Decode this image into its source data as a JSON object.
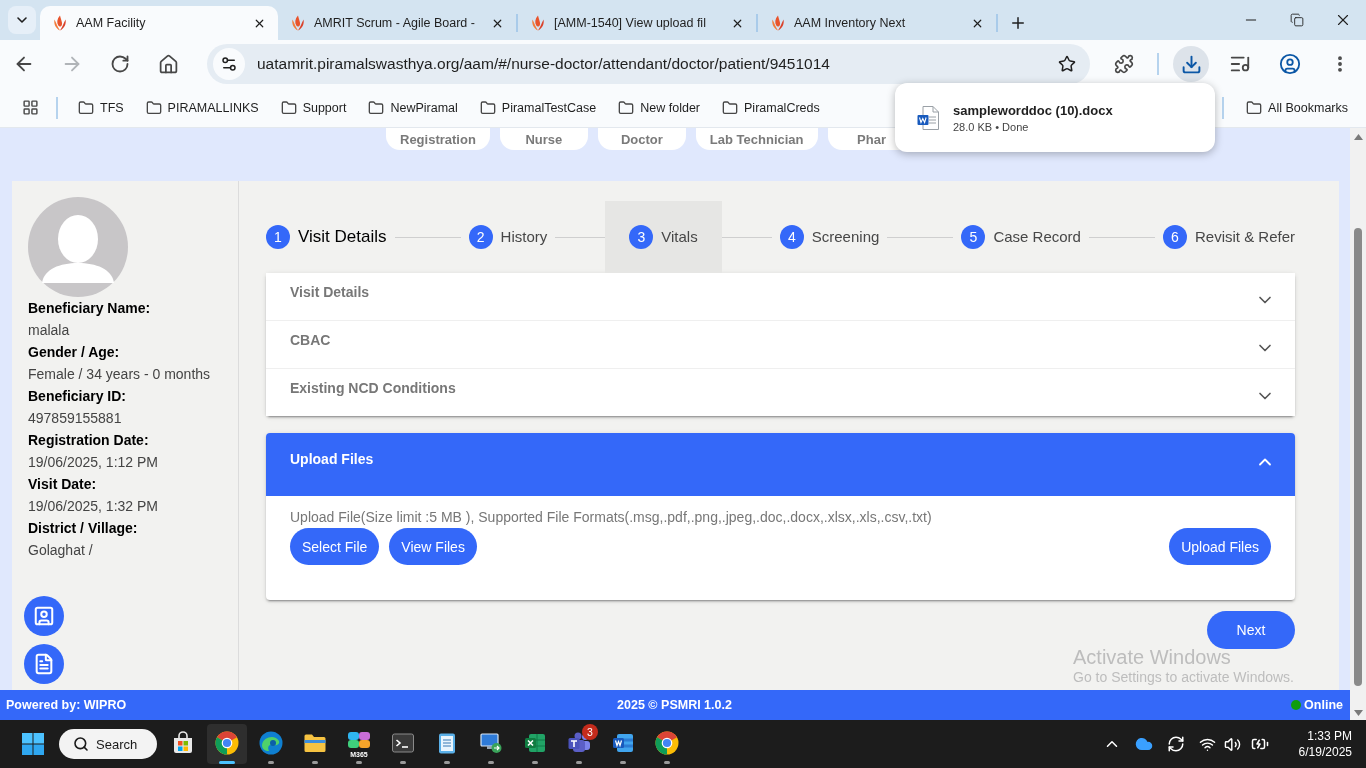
{
  "browser": {
    "tabs": [
      {
        "title": "AAM Facility",
        "selected": true
      },
      {
        "title": "AMRIT Scrum - Agile Board -",
        "selected": false
      },
      {
        "title": "[AMM-1540] View upload fil",
        "selected": false
      },
      {
        "title": "AAM Inventory Next",
        "selected": false
      }
    ],
    "forward_disabled": true,
    "url": "uatamrit.piramalswasthya.org/aam/#/nurse-doctor/attendant/doctor/patient/9451014",
    "bookmarks": [
      "TFS",
      "PIRAMALLINKS",
      "Support",
      "NewPiramal",
      "PiramalTestCase",
      "New folder",
      "PiramalCreds"
    ],
    "all_bookmarks": "All Bookmarks",
    "download": {
      "file_name": "sampleworddoc (10).docx",
      "status": "28.0 KB • Done"
    }
  },
  "roles": [
    "Registration",
    "Nurse",
    "Doctor",
    "Lab Technician",
    "Phar"
  ],
  "beneficiary": [
    {
      "label": "Beneficiary Name:",
      "value": "malala"
    },
    {
      "label": "Gender / Age:",
      "value": "Female / 34 years - 0 months"
    },
    {
      "label": "Beneficiary ID:",
      "value": "497859155881"
    },
    {
      "label": "Registration Date:",
      "value": "19/06/2025, 1:12 PM"
    },
    {
      "label": "Visit Date:",
      "value": "19/06/2025, 1:32 PM"
    },
    {
      "label": "District / Village:",
      "value": "Golaghat /"
    }
  ],
  "stepper": [
    {
      "number": "1",
      "label": "Visit Details",
      "selected": true,
      "hovered": false
    },
    {
      "number": "2",
      "label": "History",
      "selected": false,
      "hovered": false
    },
    {
      "number": "3",
      "label": "Vitals",
      "selected": false,
      "hovered": true
    },
    {
      "number": "4",
      "label": "Screening",
      "selected": false,
      "hovered": false
    },
    {
      "number": "5",
      "label": "Case Record",
      "selected": false,
      "hovered": false
    },
    {
      "number": "6",
      "label": "Revisit & Refer",
      "selected": false,
      "hovered": false
    }
  ],
  "sections": [
    {
      "title": "Visit Details",
      "expanded": false
    },
    {
      "title": "CBAC",
      "expanded": false
    },
    {
      "title": "Existing NCD Conditions",
      "expanded": false
    }
  ],
  "upload_panel": {
    "title": "Upload Files",
    "expanded": true,
    "hint": "Upload File(Size limit :5 MB ), Supported File Formats(.msg,.pdf,.png,.jpeg,.doc,.docx,.xlsx,.xls,.csv,.txt)",
    "buttons": [
      "Select File",
      "View Files"
    ],
    "upload_button": "Upload Files"
  },
  "next_button": "Next",
  "footer": {
    "powered_by": "Powered by: WIPRO",
    "copyright": "2025 © PSMRI 1.0.2",
    "status": "Online",
    "online": true
  },
  "activation_notice": {
    "title": "Activate Windows",
    "subtitle": "Go to Settings to activate Windows."
  },
  "taskbar": {
    "search": "Search",
    "apps": [
      {
        "kind": "store",
        "running": false,
        "selected": false
      },
      {
        "kind": "chrome",
        "running": true,
        "selected": true
      },
      {
        "kind": "edge",
        "running": true,
        "selected": false
      },
      {
        "kind": "explorer",
        "running": true,
        "selected": false
      },
      {
        "kind": "copilot",
        "label": "M365",
        "running": true,
        "selected": false
      },
      {
        "kind": "terminal",
        "running": true,
        "selected": false
      },
      {
        "kind": "notepad",
        "running": true,
        "selected": false
      },
      {
        "kind": "remote",
        "running": true,
        "selected": false
      },
      {
        "kind": "excel",
        "running": true,
        "selected": false
      },
      {
        "kind": "teams",
        "badge": "3",
        "running": true,
        "selected": false
      },
      {
        "kind": "word",
        "running": true,
        "selected": false
      },
      {
        "kind": "chrome",
        "running": true,
        "selected": false
      }
    ],
    "time": "1:33 PM",
    "date": "6/19/2025"
  }
}
